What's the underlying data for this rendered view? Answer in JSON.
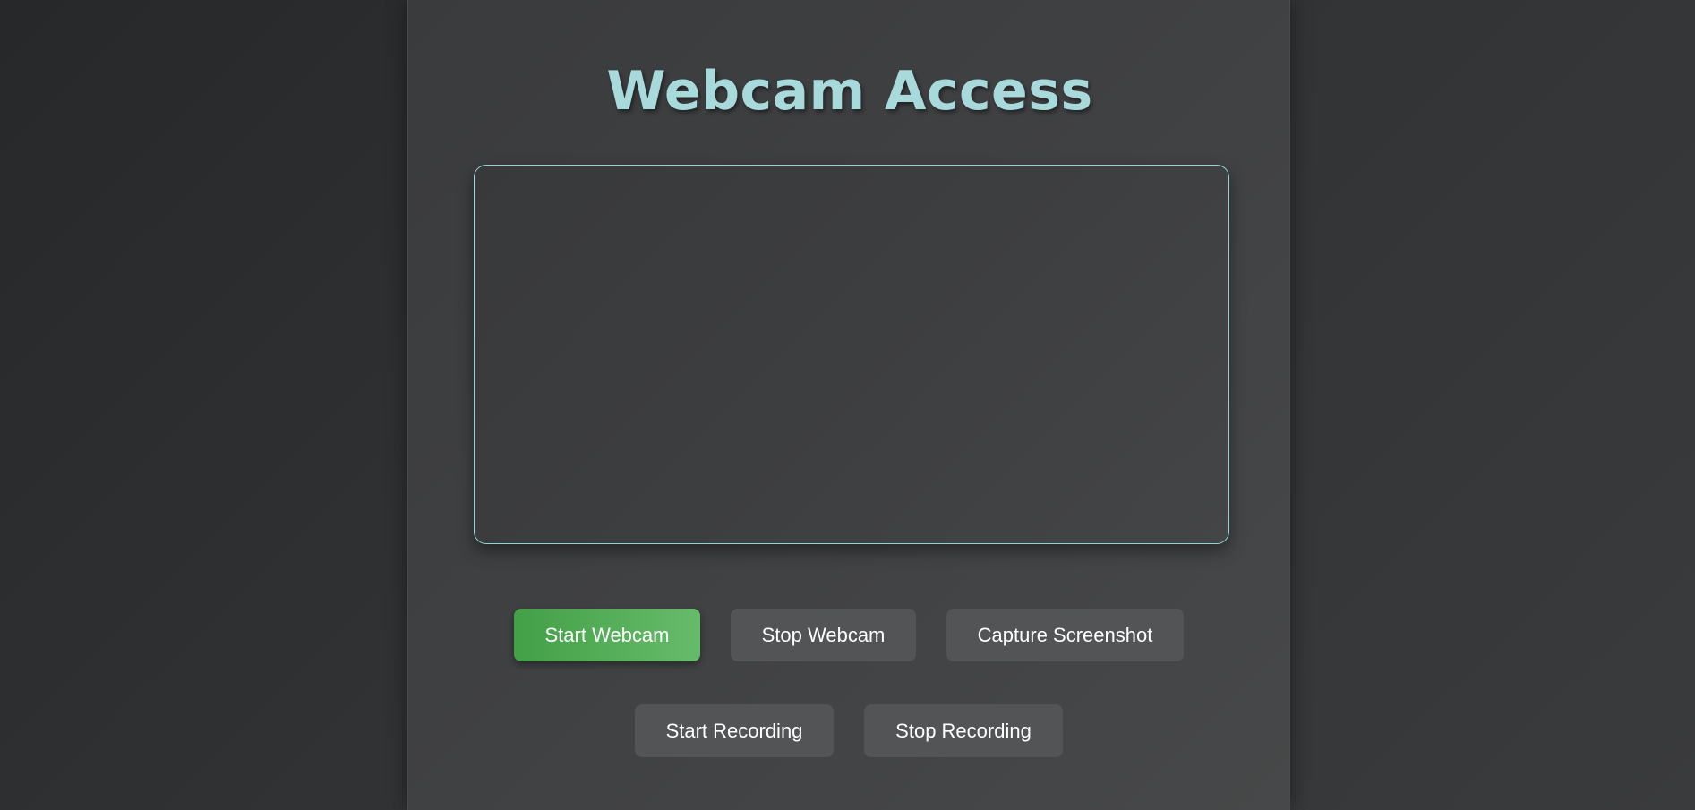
{
  "page": {
    "title": "Webcam Access"
  },
  "controls": {
    "start_webcam": "Start Webcam",
    "stop_webcam": "Stop Webcam",
    "capture_screenshot": "Capture Screenshot",
    "start_recording": "Start Recording",
    "stop_recording": "Stop Recording"
  },
  "colors": {
    "title": "#a9dadb",
    "accent_border": "#8fd4d6",
    "primary_button_start": "#43a047",
    "primary_button_end": "#66bb6a",
    "secondary_button": "#535456"
  }
}
